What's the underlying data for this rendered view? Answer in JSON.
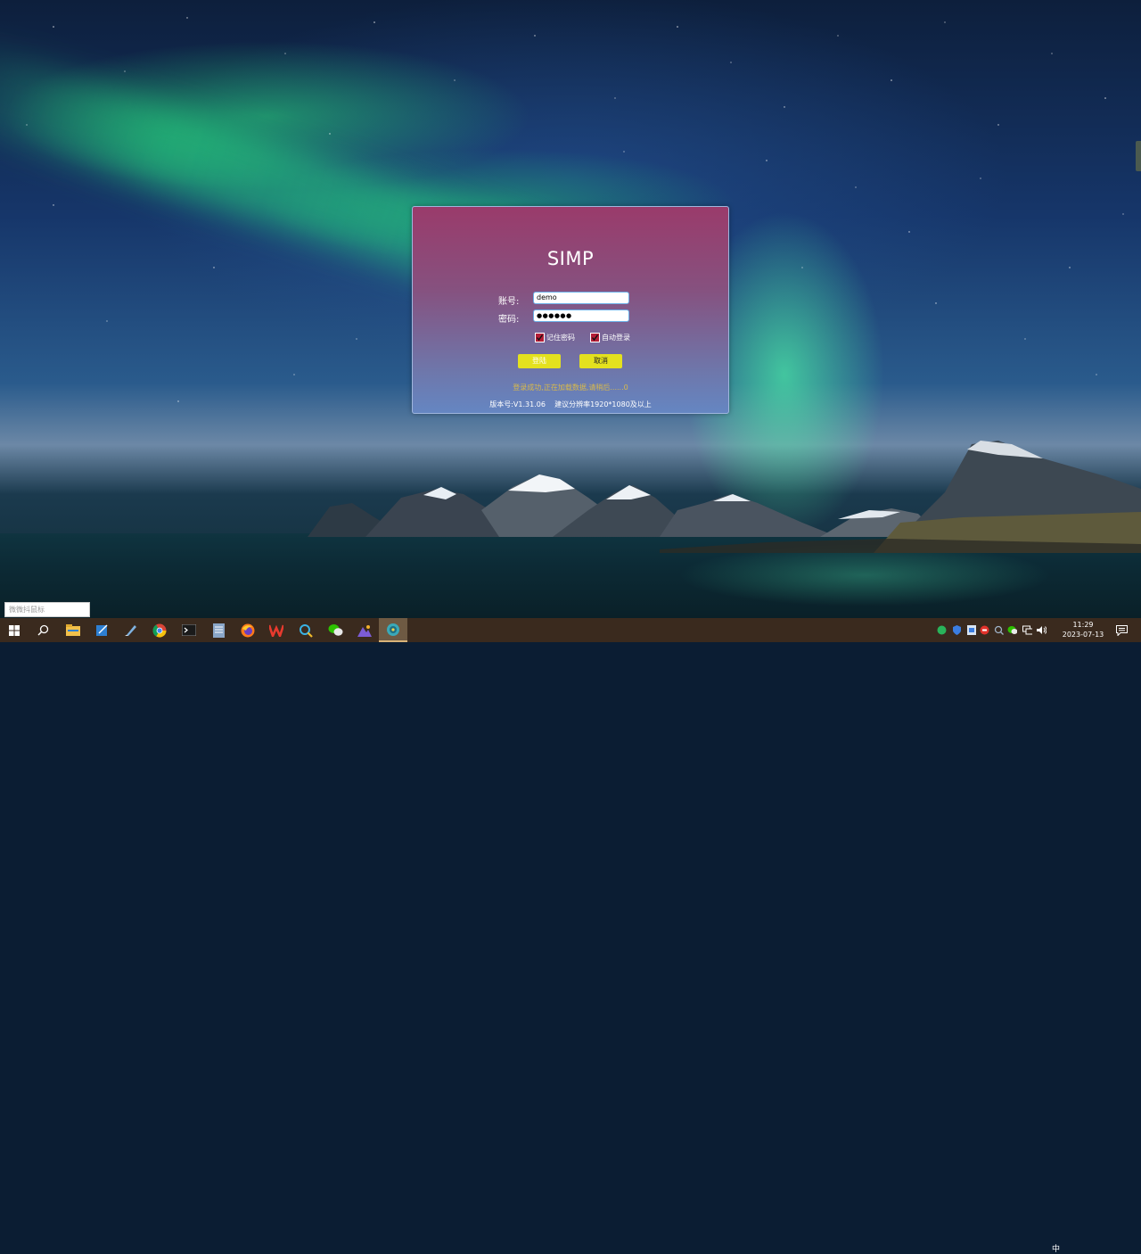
{
  "login": {
    "title": "SIMP",
    "account_label": "账号:",
    "account_value": "demo",
    "password_label": "密码:",
    "password_value": "●●●●●●",
    "remember_label": "记住密码",
    "remember_checked": true,
    "autologin_label": "自动登录",
    "autologin_checked": true,
    "login_button": "登陆",
    "cancel_button": "取消",
    "status_message": "登录成功,正在加载数据,请稍后......0",
    "version_text": "版本号:V1.31.06    建议分辨率1920*1080及以上",
    "colors": {
      "gradient_top": "#9a3b6b",
      "gradient_bottom": "#6586c2",
      "button": "#e4e11e",
      "status": "#d9b94a"
    }
  },
  "desktop": {
    "search_placeholder": "微微抖鼠标"
  },
  "taskbar": {
    "apps": [
      {
        "name": "start-icon"
      },
      {
        "name": "search-icon"
      },
      {
        "name": "file-explorer-icon"
      },
      {
        "name": "notepad-icon"
      },
      {
        "name": "edit-app-icon"
      },
      {
        "name": "chrome-icon"
      },
      {
        "name": "terminal-icon"
      },
      {
        "name": "document-icon"
      },
      {
        "name": "firefox-icon"
      },
      {
        "name": "wps-icon"
      },
      {
        "name": "magnifier-app-icon"
      },
      {
        "name": "wechat-icon"
      },
      {
        "name": "photos-icon"
      },
      {
        "name": "simp-app-icon"
      }
    ],
    "ime": "中",
    "time": "11:29",
    "date": "2023-07-13"
  }
}
